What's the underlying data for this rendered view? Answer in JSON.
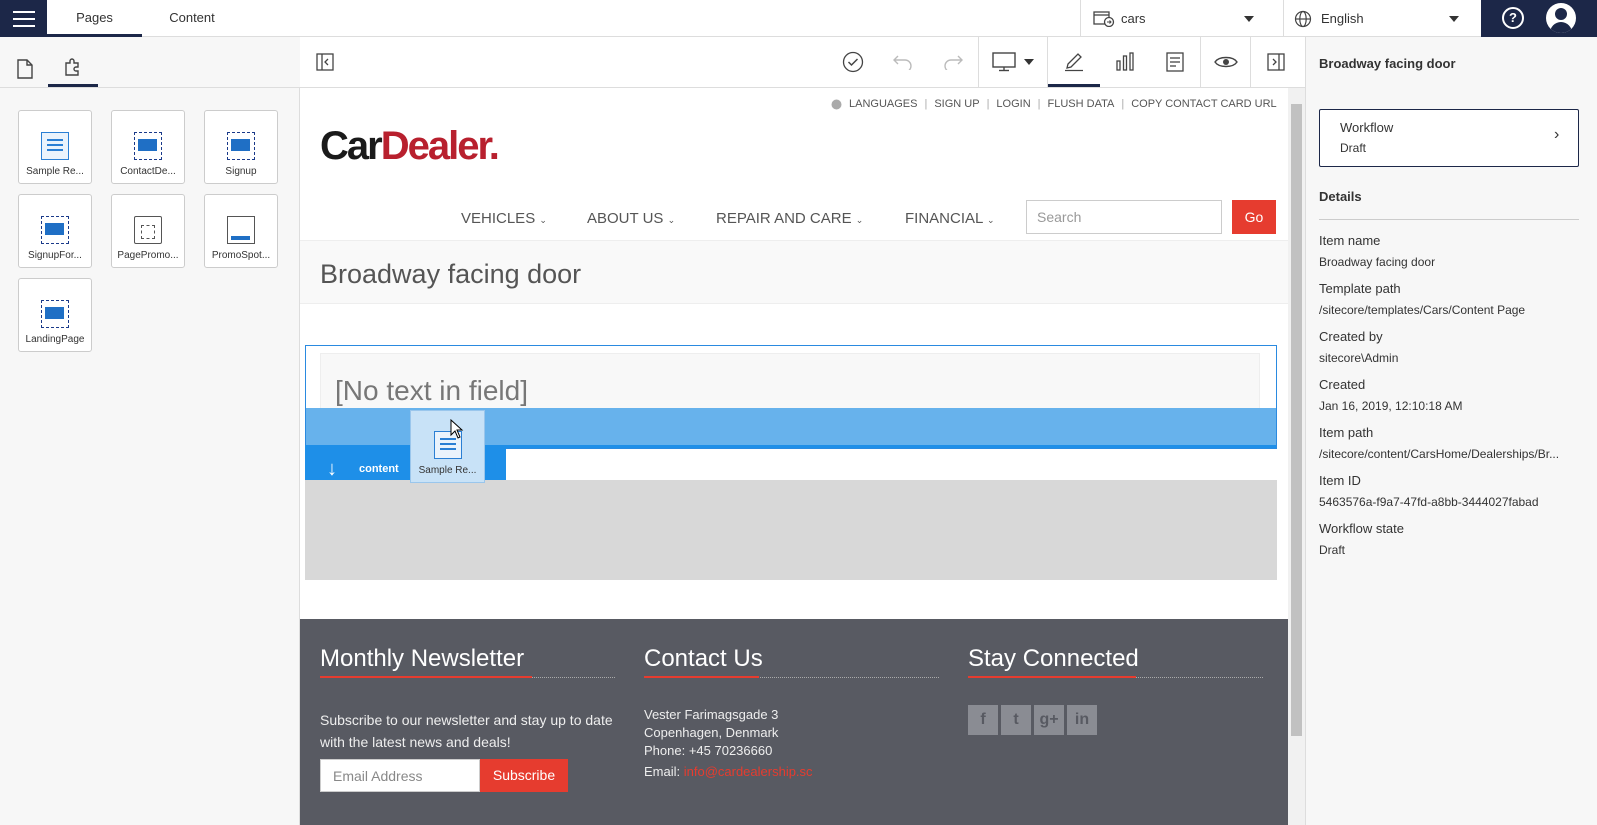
{
  "topbar": {
    "tabs": [
      "Pages",
      "Content"
    ],
    "site": "cars",
    "language": "English",
    "help_label": "?"
  },
  "renderings": [
    {
      "label": "Sample Re...",
      "icon": "text-rendering-icon"
    },
    {
      "label": "ContactDe...",
      "icon": "placeholder-rendering-icon"
    },
    {
      "label": "Signup",
      "icon": "placeholder-rendering-icon"
    },
    {
      "label": "SignupFor...",
      "icon": "placeholder-rendering-icon"
    },
    {
      "label": "PagePromo...",
      "icon": "page-promo-icon"
    },
    {
      "label": "PromoSpot...",
      "icon": "promo-spot-icon"
    },
    {
      "label": "LandingPage",
      "icon": "placeholder-rendering-icon"
    }
  ],
  "site": {
    "top_links": [
      "LANGUAGES",
      "SIGN UP",
      "LOGIN",
      "FLUSH DATA",
      "COPY CONTACT CARD URL"
    ],
    "logo_car": "Car",
    "logo_dealer": "Dealer.",
    "nav": [
      "VEHICLES",
      "ABOUT US",
      "REPAIR AND CARE",
      "FINANCIAL"
    ],
    "search_placeholder": "Search",
    "go_label": "Go",
    "page_title": "Broadway facing door",
    "empty_field": "[No text in field]",
    "placeholder_name": "content",
    "drag_label": "Sample Re...",
    "footer": {
      "newsletter_title": "Monthly Newsletter",
      "newsletter_text": "Subscribe to our newsletter and stay up to date with the latest news and deals!",
      "email_placeholder": "Email Address",
      "subscribe_label": "Subscribe",
      "contact_title": "Contact Us",
      "address1": "Vester Farimagsgade 3",
      "address2": "Copenhagen, Denmark",
      "phone": "Phone: +45 70236660",
      "email_label": "Email: ",
      "email_value": "info@cardealership.sc",
      "social_title": "Stay Connected",
      "social": [
        "f",
        "t",
        "g+",
        "in"
      ]
    }
  },
  "properties": {
    "title": "Broadway facing door",
    "workflow_label": "Workflow",
    "workflow_value": "Draft",
    "details_heading": "Details",
    "fields": [
      {
        "label": "Item name",
        "value": "Broadway facing door"
      },
      {
        "label": "Template path",
        "value": "/sitecore/templates/Cars/Content Page"
      },
      {
        "label": "Created by",
        "value": "sitecore\\Admin"
      },
      {
        "label": "Created",
        "value": "Jan 16, 2019, 12:10:18 AM"
      },
      {
        "label": "Item path",
        "value": "/sitecore/content/CarsHome/Dealerships/Br..."
      },
      {
        "label": "Item ID",
        "value": "5463576a-f9a7-47fd-a8bb-3444027fabad"
      },
      {
        "label": "Workflow state",
        "value": "Draft"
      }
    ]
  },
  "colors": {
    "navy": "#1c2748",
    "accent_blue": "#1e8fe8",
    "brand_red": "#e63c2f"
  }
}
